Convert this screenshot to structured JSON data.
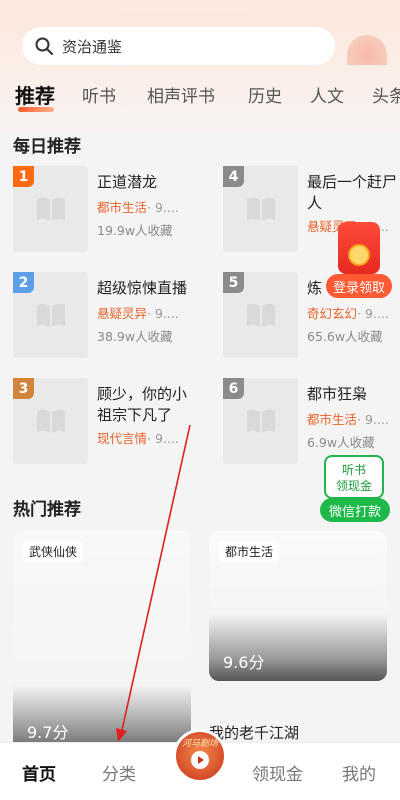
{
  "search": {
    "placeholder": "资治通鉴"
  },
  "tabs": [
    {
      "label": "推荐",
      "active": true
    },
    {
      "label": "听书"
    },
    {
      "label": "相声评书"
    },
    {
      "label": "历史"
    },
    {
      "label": "人文"
    },
    {
      "label": "头条"
    }
  ],
  "daily": {
    "title": "每日推荐",
    "books": [
      {
        "rank": "1",
        "rank_color": "#ff6a13",
        "title": "正道潜龙",
        "genre": "都市生活",
        "genre_more": "· 9....",
        "favorites": "19.9w人收藏"
      },
      {
        "rank": "4",
        "rank_color": "#8b8b8b",
        "title": "最后一个赶尸人",
        "genre": "悬疑灵异",
        "genre_more": "· 9....",
        "favorites": ""
      },
      {
        "rank": "2",
        "rank_color": "#5d9ee8",
        "title": "超级惊悚直播",
        "genre": "悬疑灵异",
        "genre_more": "· 9....",
        "favorites": "38.9w人收藏"
      },
      {
        "rank": "5",
        "rank_color": "#8b8b8b",
        "title": "炼",
        "genre": "奇幻玄幻",
        "genre_more": "· 9....",
        "favorites": "65.6w人收藏"
      },
      {
        "rank": "3",
        "rank_color": "#d2833c",
        "title": "顾少，你的小祖宗下凡了",
        "genre": "现代言情",
        "genre_more": "· 9....",
        "favorites": ""
      },
      {
        "rank": "6",
        "rank_color": "#8b8b8b",
        "title": "都市狂枭",
        "genre": "都市生活",
        "genre_more": "· 9....",
        "favorites": "6.9w人收藏"
      }
    ]
  },
  "floats": {
    "redpacket_label": "登录领取",
    "listen_line1": "听书",
    "listen_line2": "领现金",
    "wechat_label": "微信打款"
  },
  "hot": {
    "title": "热门推荐",
    "cards": [
      {
        "tag": "武侠仙侠",
        "score": "9.7分",
        "title": ""
      },
      {
        "tag": "都市生活",
        "score": "9.6分",
        "title": "我的老千江湖"
      }
    ]
  },
  "nav": {
    "items": [
      "首页",
      "分类",
      "领现金",
      "我的"
    ],
    "center_text": "河马剧场"
  },
  "colors": {
    "accent": "#ff5a2a",
    "genre": "#e8632a",
    "green": "#1fb94a"
  }
}
